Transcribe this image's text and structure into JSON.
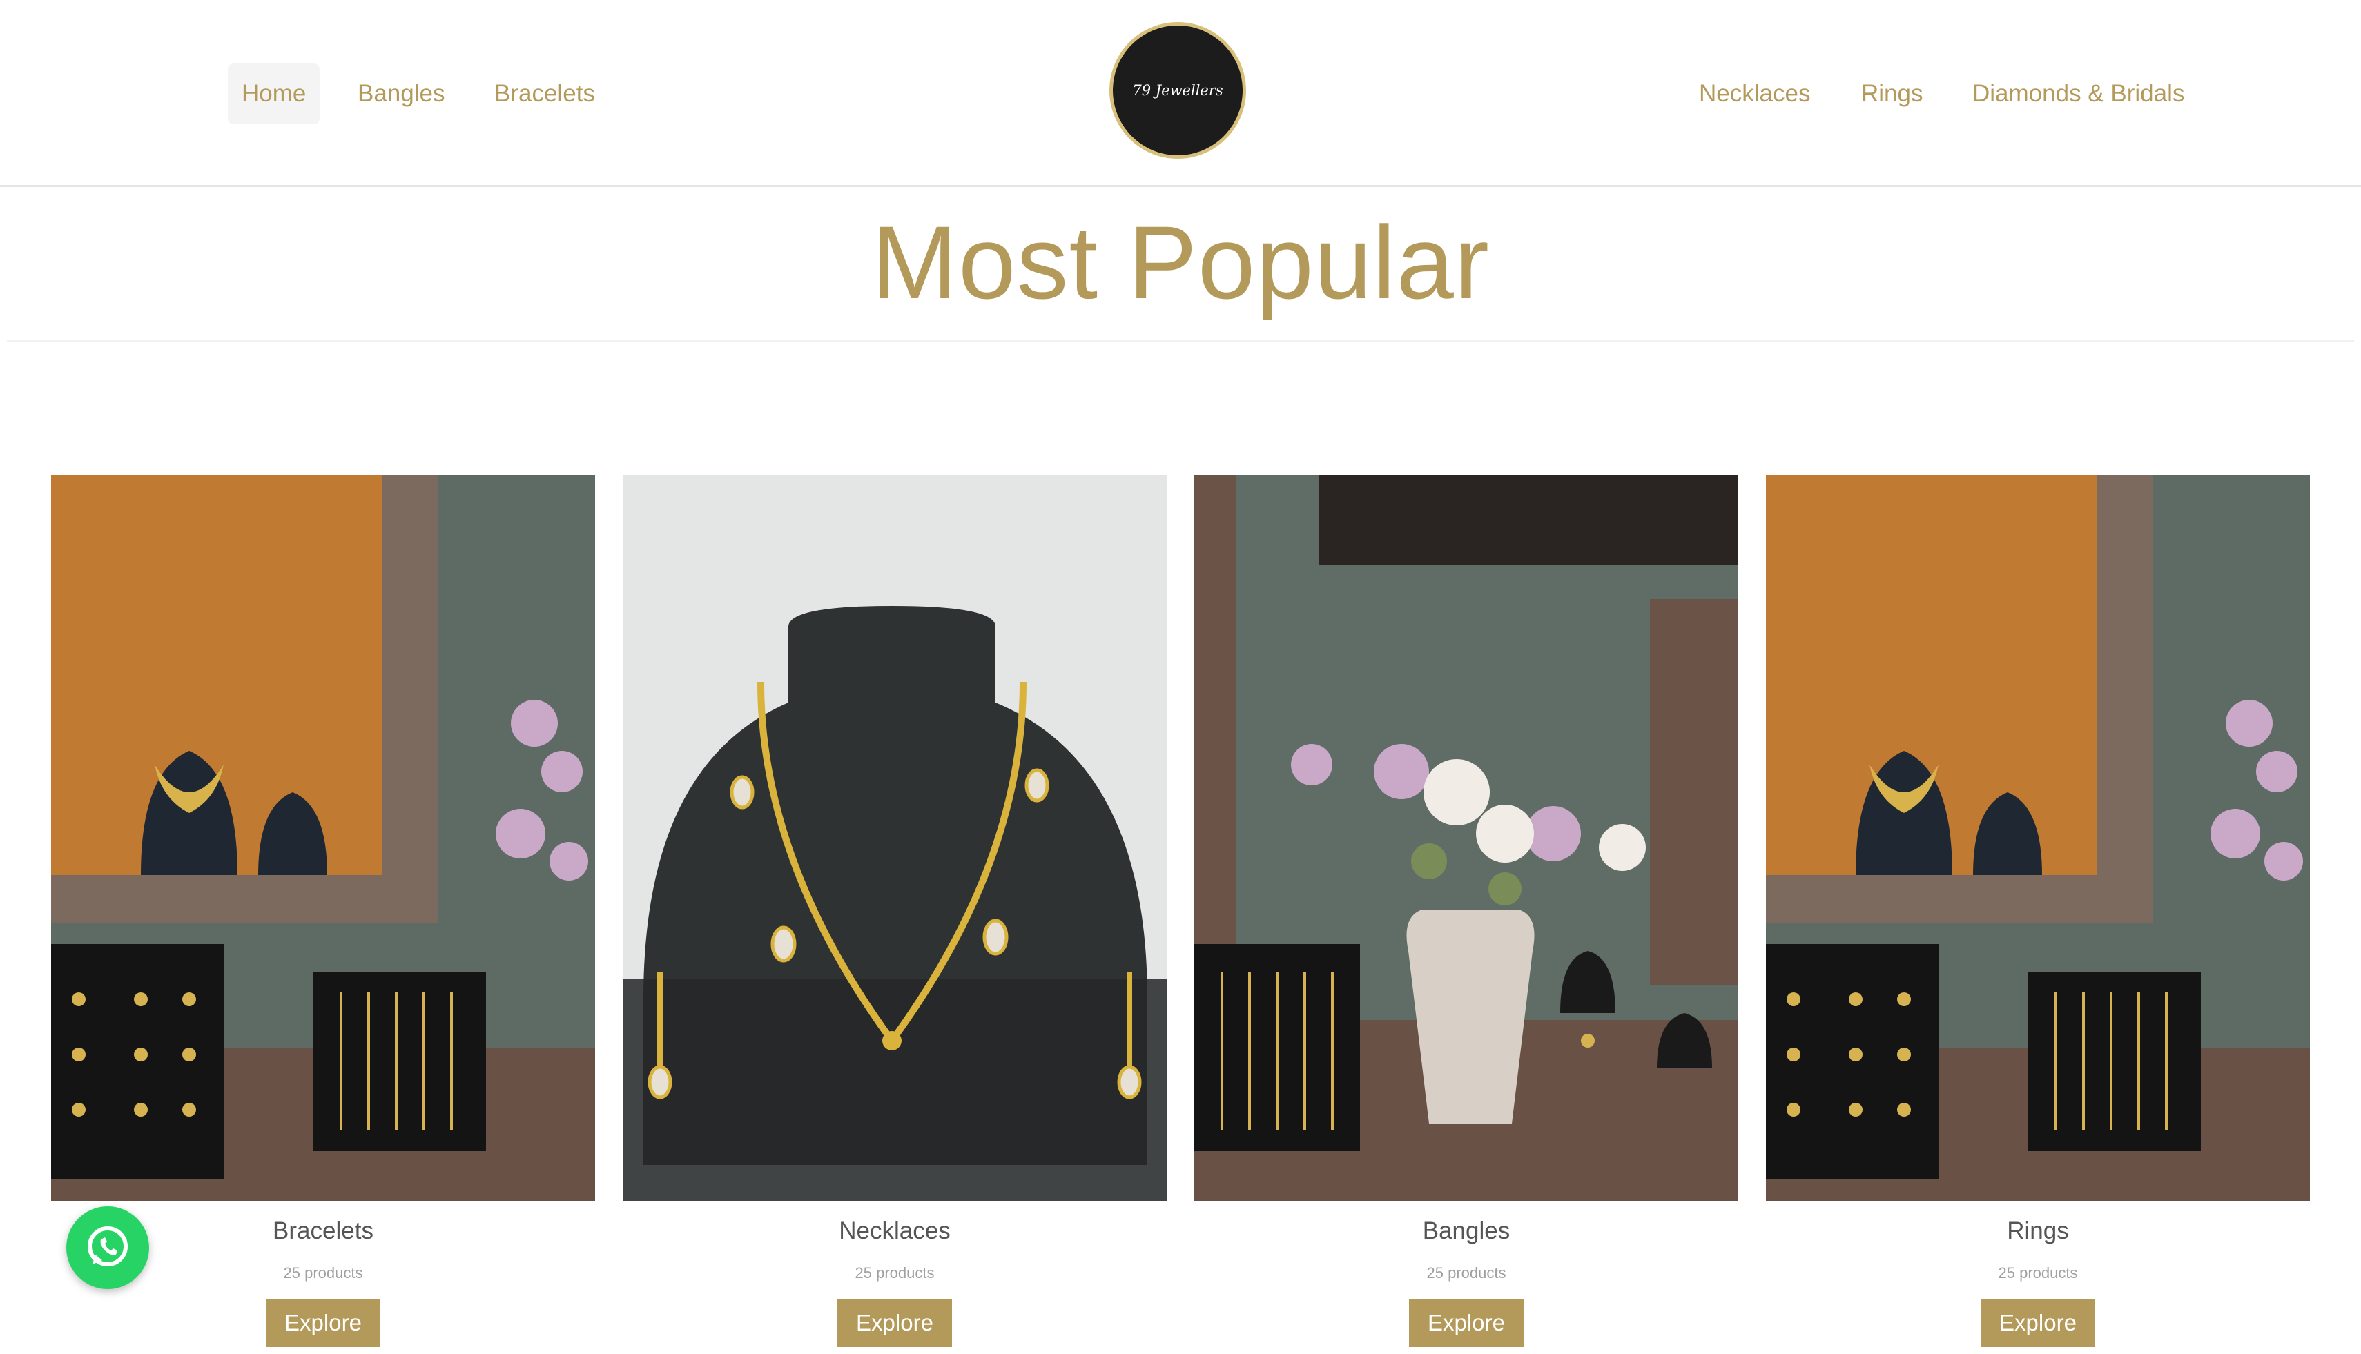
{
  "header": {
    "nav_left": [
      {
        "label": "Home",
        "active": true
      },
      {
        "label": "Bangles",
        "active": false
      },
      {
        "label": "Bracelets",
        "active": false
      }
    ],
    "logo_text": "79 Jewellers",
    "nav_right": [
      {
        "label": "Necklaces"
      },
      {
        "label": "Rings"
      },
      {
        "label": "Diamonds & Bridals"
      }
    ]
  },
  "section": {
    "title": "Most Popular"
  },
  "products": [
    {
      "name": "Bracelets",
      "count": "25 products",
      "button": "Explore",
      "photo": "jewellery-display-shelf-photo"
    },
    {
      "name": "Necklaces",
      "count": "25 products",
      "button": "Explore",
      "photo": "gold-necklace-on-bust-photo"
    },
    {
      "name": "Bangles",
      "count": "25 products",
      "button": "Explore",
      "photo": "flower-vase-display-photo"
    },
    {
      "name": "Rings",
      "count": "25 products",
      "button": "Explore",
      "photo": "jewellery-display-shelf-photo"
    }
  ],
  "floating": {
    "whatsapp_icon": "whatsapp-icon"
  },
  "colors": {
    "accent": "#b49a5a",
    "whatsapp": "#28d366",
    "logo_bg": "#1c1c1c"
  }
}
